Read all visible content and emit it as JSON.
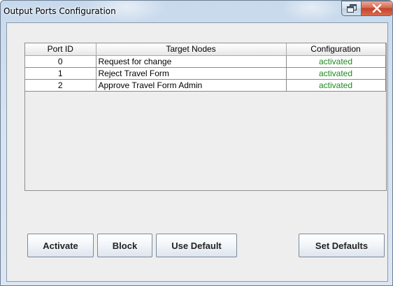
{
  "window": {
    "title": "Output Ports Configuration"
  },
  "caption_buttons": {
    "restore_icon": "restore-icon",
    "close_icon": "close-icon"
  },
  "table": {
    "columns": [
      "Port ID",
      "Target Nodes",
      "Configuration"
    ],
    "rows": [
      {
        "port_id": "0",
        "target_node": "Request for change",
        "configuration": "activated"
      },
      {
        "port_id": "1",
        "target_node": "Reject Travel Form",
        "configuration": "activated"
      },
      {
        "port_id": "2",
        "target_node": "Approve Travel Form Admin",
        "configuration": "activated"
      }
    ]
  },
  "buttons": {
    "activate": "Activate",
    "block": "Block",
    "use_default": "Use Default",
    "set_defaults": "Set Defaults"
  },
  "colors": {
    "activated_text": "#1d8a1d",
    "close_button": "#c4432a"
  }
}
